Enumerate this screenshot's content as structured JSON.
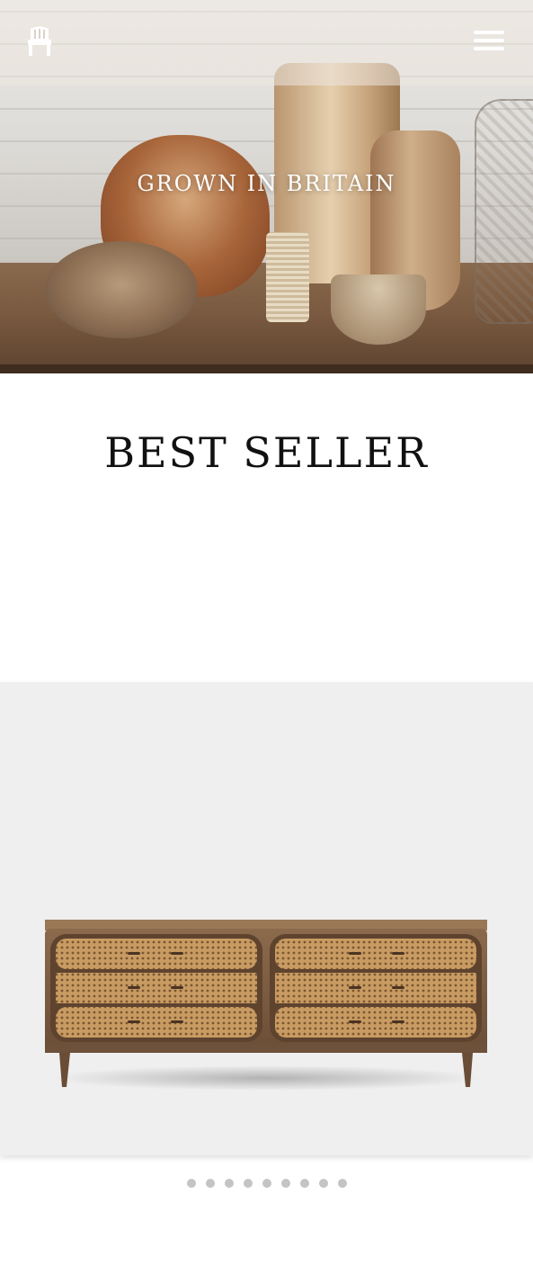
{
  "header": {
    "logo_icon": "chair-icon",
    "menu_icon": "hamburger-menu-icon"
  },
  "hero": {
    "title": "GROWN IN BRITAIN"
  },
  "best_seller": {
    "title": "BEST SELLER"
  },
  "carousel": {
    "slide_count": 9,
    "active_index": 0,
    "dot_color": "#c4c4c4"
  },
  "colors": {
    "card_background": "#efefef",
    "text": "#111111"
  }
}
